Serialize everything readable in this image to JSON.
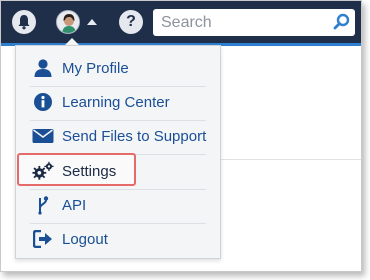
{
  "topbar": {
    "search_placeholder": "Search",
    "help_label": "?",
    "accent_color": "#1f2e49",
    "stripe_color": "#2f7fd0"
  },
  "menu": {
    "items": [
      {
        "label": "My Profile",
        "icon": "user-icon"
      },
      {
        "label": "Learning Center",
        "icon": "info-icon"
      },
      {
        "label": "Send Files to Support",
        "icon": "envelope-icon"
      },
      {
        "label": "Settings",
        "icon": "gears-icon",
        "highlighted": true
      },
      {
        "label": "API",
        "icon": "branch-icon"
      },
      {
        "label": "Logout",
        "icon": "logout-icon"
      }
    ],
    "highlight_color": "#e56a6a",
    "label_color": "#1a4f96"
  }
}
